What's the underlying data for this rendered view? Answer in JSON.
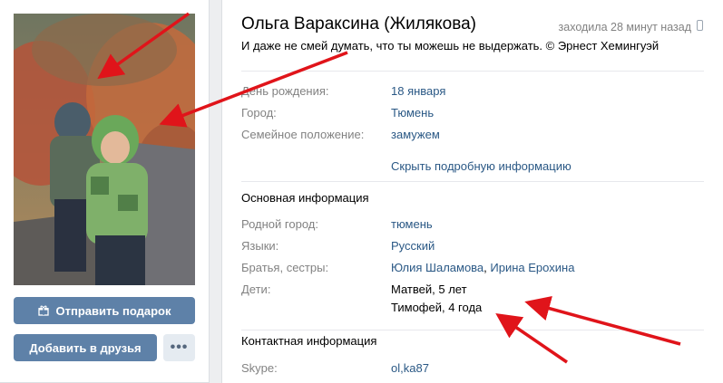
{
  "profile": {
    "name": "Ольга Вараксина (Жилякова)",
    "last_seen": "заходила 28 минут назад",
    "status_quote": "И даже не смей думать, что ты можешь не выдержать. © Эрнест Хемингуэй"
  },
  "buttons": {
    "send_gift": "Отправить подарок",
    "add_friend": "Добавить в друзья",
    "more": "•••"
  },
  "brief_info": [
    {
      "label": "День рождения:",
      "value": "18 января"
    },
    {
      "label": "Город:",
      "value": "Тюмень"
    },
    {
      "label": "Семейное положение:",
      "value": "замужем"
    }
  ],
  "toggle_details": "Скрыть подробную информацию",
  "main_info": {
    "title": "Основная информация",
    "hometown_label": "Родной город:",
    "hometown_value": "тюмень",
    "languages_label": "Языки:",
    "languages_value": "Русский",
    "siblings_label": "Братья, сестры:",
    "siblings": [
      "Юлия Шаламова",
      "Ирина Ерохина"
    ],
    "siblings_sep": ", ",
    "children_label": "Дети:",
    "children": [
      "Матвей, 5 лет",
      "Тимофей, 4 года"
    ]
  },
  "contact_info": {
    "title": "Контактная информация",
    "skype_label": "Skype:",
    "skype_value": "ol,ka87"
  },
  "colors": {
    "accent": "#5e81a8",
    "link": "#2a5885",
    "label": "#828282",
    "annotation_arrow": "#e0141a"
  },
  "icons": [
    "gift-icon",
    "phone-icon",
    "more-icon"
  ]
}
